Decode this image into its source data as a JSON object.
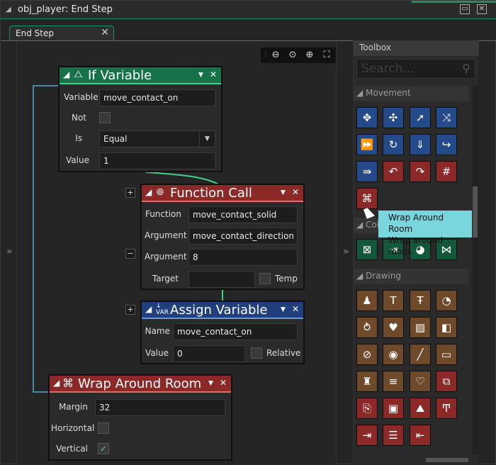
{
  "window": {
    "title": "obj_player: End Step",
    "minimize_glyph": "▭",
    "close_glyph": "✕"
  },
  "tab": {
    "label": "End Step",
    "close_glyph": "✕"
  },
  "zoom": {
    "zoom_out": "⊖",
    "zoom_reset": "⊙",
    "zoom_in": "⊕",
    "fit": "⛶"
  },
  "collapse": {
    "left": "»",
    "right": "»"
  },
  "blocks": {
    "if_variable": {
      "title": "If Variable",
      "variable_label": "Variable",
      "variable_value": "move_contact_on",
      "not_label": "Not",
      "is_label": "Is",
      "is_value": "Equal",
      "value_label": "Value",
      "value_value": "1"
    },
    "function_call": {
      "title": "Function Call",
      "function_label": "Function",
      "function_value": "move_contact_solid",
      "argument1_label": "Argument",
      "argument1_value": "move_contact_direction",
      "argument2_label": "Argument",
      "argument2_value": "8",
      "target_label": "Target",
      "target_value": "",
      "temp_label": "Temp",
      "plus": "+",
      "minus": "−"
    },
    "assign_variable": {
      "title": "Assign Variable",
      "name_label": "Name",
      "name_value": "move_contact_on",
      "value_label": "Value",
      "value_value": "0",
      "relative_label": "Relative",
      "plus": "+"
    },
    "wrap_around_room": {
      "title": "Wrap Around Room",
      "margin_label": "Margin",
      "margin_value": "32",
      "horizontal_label": "Horizontal",
      "vertical_label": "Vertical"
    }
  },
  "toolbox": {
    "title": "Toolbox",
    "search_placeholder": "Search...",
    "sections": {
      "movement": "Movement",
      "collisions": "Col",
      "drawing": "Drawing"
    }
  },
  "tooltip": {
    "title": "Wrap Around Room",
    "description": "Wrap around room."
  },
  "colors": {
    "accent": "#1f8f5f",
    "green_block": "#17724a",
    "red_block": "#8b2828",
    "blue_block": "#213f7e",
    "tooltip": "#78d6dc"
  }
}
